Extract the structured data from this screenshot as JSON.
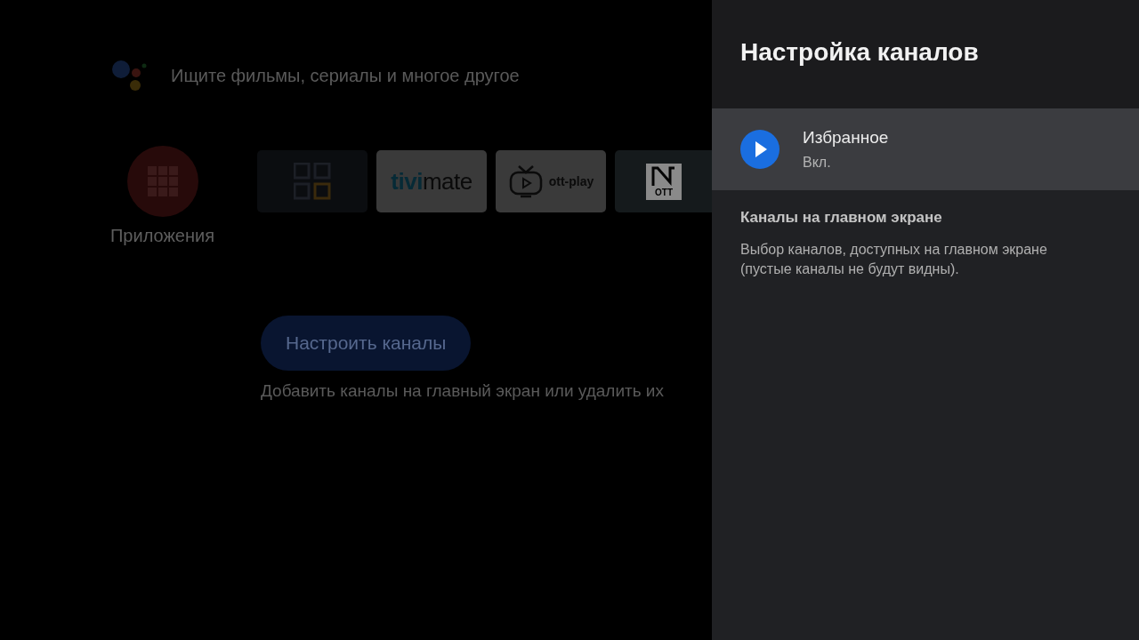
{
  "search": {
    "placeholder": "Ищите фильмы, сериалы и многое другое"
  },
  "apps": {
    "label": "Приложения"
  },
  "tiles": [
    {
      "kind": "grid"
    },
    {
      "kind": "tivimate",
      "parts": [
        "tivi",
        "mate"
      ]
    },
    {
      "kind": "ottplay",
      "parts": [
        "ott-play"
      ]
    },
    {
      "kind": "nott",
      "parts": [
        "OTT"
      ]
    }
  ],
  "customize_button": "Настроить каналы",
  "customize_hint": "Добавить каналы на главный экран или удалить их",
  "panel": {
    "title": "Настройка каналов",
    "items": [
      {
        "name": "Избранное",
        "status": "Вкл.",
        "selected": true
      }
    ],
    "section_title": "Каналы на главном экране",
    "section_text": "Выбор каналов, доступных на главном экране (пустые каналы не будут видны)."
  }
}
